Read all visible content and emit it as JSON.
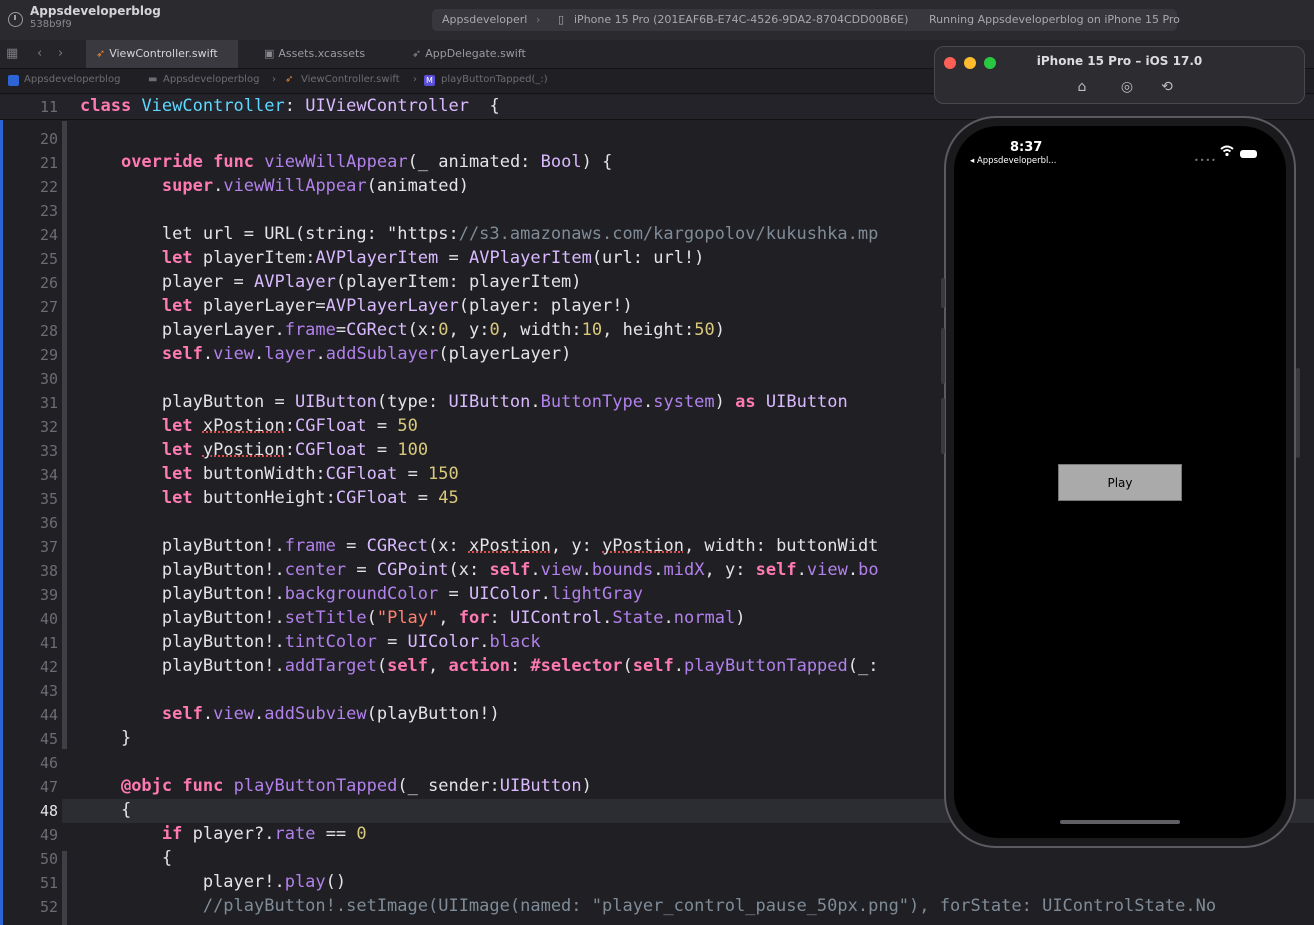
{
  "toolbar": {
    "project_name": "Appsdeveloperblog",
    "project_sub": "538b9f9",
    "scheme": "Appsdeveloperl",
    "destination": "iPhone 15 Pro (201EAF6B-E74C-4526-9DA2-8704CDD00B6E)",
    "status": "Running Appsdeveloperblog on iPhone 15 Pro"
  },
  "tabs": [
    {
      "label": "ViewController.swift",
      "icon": "swift-file-icon",
      "active": true
    },
    {
      "label": "Assets.xcassets",
      "icon": "asset-catalog-icon",
      "active": false
    },
    {
      "label": "AppDelegate.swift",
      "icon": "swift-file-icon",
      "active": false
    }
  ],
  "jumpbar": {
    "target": "Appsdeveloperblog",
    "folder": "Appsdeveloperblog",
    "file": "ViewController.swift",
    "symbol": "playButtonTapped(_:)"
  },
  "editor": {
    "sticky_line_no": "11",
    "sticky_line": "class ViewController: UIViewController  {",
    "current_line": "48",
    "lines": [
      {
        "n": "20",
        "t": ""
      },
      {
        "n": "21",
        "t": "    override func viewWillAppear(_ animated: Bool) {"
      },
      {
        "n": "22",
        "t": "        super.viewWillAppear(animated)"
      },
      {
        "n": "23",
        "t": ""
      },
      {
        "n": "24",
        "t": "        let url = URL(string: \"https://s3.amazonaws.com/kargopolov/kukushka.mp"
      },
      {
        "n": "25",
        "t": "        let playerItem:AVPlayerItem = AVPlayerItem(url: url!)"
      },
      {
        "n": "26",
        "t": "        player = AVPlayer(playerItem: playerItem)"
      },
      {
        "n": "27",
        "t": "        let playerLayer=AVPlayerLayer(player: player!)"
      },
      {
        "n": "28",
        "t": "        playerLayer.frame=CGRect(x:0, y:0, width:10, height:50)"
      },
      {
        "n": "29",
        "t": "        self.view.layer.addSublayer(playerLayer)"
      },
      {
        "n": "30",
        "t": ""
      },
      {
        "n": "31",
        "t": "        playButton = UIButton(type: UIButton.ButtonType.system) as UIButton"
      },
      {
        "n": "32",
        "t": "        let xPostion:CGFloat = 50"
      },
      {
        "n": "33",
        "t": "        let yPostion:CGFloat = 100"
      },
      {
        "n": "34",
        "t": "        let buttonWidth:CGFloat = 150"
      },
      {
        "n": "35",
        "t": "        let buttonHeight:CGFloat = 45"
      },
      {
        "n": "36",
        "t": ""
      },
      {
        "n": "37",
        "t": "        playButton!.frame = CGRect(x: xPostion, y: yPostion, width: buttonWidt"
      },
      {
        "n": "38",
        "t": "        playButton!.center = CGPoint(x: self.view.bounds.midX, y: self.view.bo"
      },
      {
        "n": "39",
        "t": "        playButton!.backgroundColor = UIColor.lightGray"
      },
      {
        "n": "40",
        "t": "        playButton!.setTitle(\"Play\", for: UIControl.State.normal)"
      },
      {
        "n": "41",
        "t": "        playButton!.tintColor = UIColor.black"
      },
      {
        "n": "42",
        "t": "        playButton!.addTarget(self, action: #selector(self.playButtonTapped(_:"
      },
      {
        "n": "43",
        "t": ""
      },
      {
        "n": "44",
        "t": "        self.view.addSubview(playButton!)"
      },
      {
        "n": "45",
        "t": "    }"
      },
      {
        "n": "46",
        "t": ""
      },
      {
        "n": "47",
        "t": "    @objc func playButtonTapped(_ sender:UIButton)"
      },
      {
        "n": "48",
        "t": "    {"
      },
      {
        "n": "49",
        "t": "        if player?.rate == 0"
      },
      {
        "n": "50",
        "t": "        {"
      },
      {
        "n": "51",
        "t": "            player!.play()"
      },
      {
        "n": "52",
        "t": "            //playButton!.setImage(UIImage(named: \"player_control_pause_50px.png\"), forState: UIControlState.No"
      }
    ]
  },
  "simulator": {
    "title": "iPhone 15 Pro – iOS 17.0",
    "time": "8:37",
    "back_label": "◂ Appsdeveloperbl...",
    "play_button": "Play",
    "buttons": [
      "home-icon",
      "screenshot-icon",
      "rotate-icon"
    ]
  },
  "colors": {
    "keyword": "#ff7ab2",
    "type": "#dabaff",
    "string": "#ff8170",
    "number": "#d9c97c",
    "comment": "#7f8c98",
    "swift_icon": "#e8883a"
  }
}
